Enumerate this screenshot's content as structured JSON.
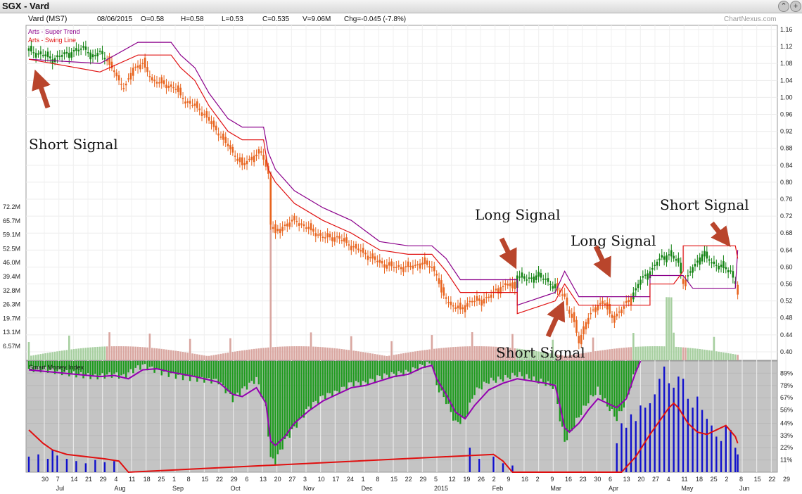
{
  "window": {
    "title": "SGX - Vard"
  },
  "info": {
    "symbol": "Vard (MS7)",
    "date": "08/06/2015",
    "open": "O=0.58",
    "high": "H=0.58",
    "low": "L=0.53",
    "close": "C=0.535",
    "volume": "V=9.06M",
    "change": "Chg=-0.045 (-7.8%)",
    "brand": "ChartNexus.com"
  },
  "legend": {
    "super_trend": "Arts - Super Trend",
    "swing_line": "Arts - Swing Line",
    "smi": "Smart Money Index"
  },
  "annotations": {
    "short1": "Short Signal",
    "long1": "Long Signal",
    "long2": "Long Signal",
    "short2": "Short Signal",
    "short3": "Short Signal"
  },
  "colors": {
    "down_candle": "#e8641e",
    "up_candle": "#128212",
    "super_trend": "#8b008b",
    "swing_line": "#e01010",
    "arrow": "#b9452c",
    "smi_bar": "#1c9a1c",
    "smi_bar_low": "#1111cc",
    "smi_line": "#9400b0",
    "smi_signal": "#e01010",
    "panel_bg": "#c4c4c4"
  },
  "chart_data": [
    {
      "type": "candlestick",
      "period": "Jul 2014 - Jun 2015",
      "price_axis": {
        "ticks": [
          "1.16",
          "1.12",
          "1.08",
          "1.04",
          "1.00",
          "0.96",
          "0.92",
          "0.88",
          "0.84",
          "0.80",
          "0.76",
          "0.72",
          "0.68",
          "0.64",
          "0.60",
          "0.56",
          "0.52",
          "0.48",
          "0.44",
          "0.40"
        ],
        "range": [
          0.38,
          1.17
        ]
      },
      "volume_axis": {
        "ticks": [
          "72.2M",
          "65.7M",
          "59.1M",
          "52.5M",
          "46.0M",
          "39.4M",
          "32.8M",
          "26.3M",
          "19.7M",
          "13.1M",
          "6.57M"
        ]
      },
      "x_ticks": [
        "30",
        "7",
        "14",
        "21",
        "29",
        "4",
        "11",
        "18",
        "25",
        "1",
        "8",
        "15",
        "22",
        "29",
        "6",
        "13",
        "20",
        "27",
        "3",
        "10",
        "17",
        "24",
        "1",
        "8",
        "15",
        "22",
        "29",
        "5",
        "12",
        "19",
        "26",
        "2",
        "9",
        "16",
        "2",
        "9",
        "16",
        "23",
        "30",
        "6",
        "13",
        "20",
        "27",
        "4",
        "11",
        "18",
        "25",
        "2",
        "8",
        "15",
        "22",
        "29"
      ],
      "x_months": [
        "Jul",
        "Aug",
        "Sep",
        "Oct",
        "Nov",
        "Dec",
        "2015",
        "Feb",
        "Mar",
        "Apr",
        "May",
        "Jun"
      ],
      "close_path": [
        [
          0,
          1.11
        ],
        [
          6,
          1.1
        ],
        [
          10,
          1.09
        ],
        [
          14,
          1.1
        ],
        [
          20,
          1.11
        ],
        [
          24,
          1.12
        ],
        [
          26,
          1.09
        ],
        [
          30,
          1.11
        ],
        [
          36,
          1.06
        ],
        [
          40,
          1.02
        ],
        [
          44,
          1.07
        ],
        [
          48,
          1.08
        ],
        [
          52,
          1.04
        ],
        [
          58,
          1.03
        ],
        [
          62,
          1.02
        ],
        [
          66,
          0.99
        ],
        [
          70,
          0.98
        ],
        [
          74,
          0.96
        ],
        [
          78,
          0.93
        ],
        [
          82,
          0.9
        ],
        [
          86,
          0.87
        ],
        [
          90,
          0.84
        ],
        [
          94,
          0.86
        ],
        [
          98,
          0.87
        ],
        [
          101,
          0.82
        ],
        [
          102,
          0.7
        ],
        [
          104,
          0.68
        ],
        [
          108,
          0.7
        ],
        [
          112,
          0.71
        ],
        [
          118,
          0.69
        ],
        [
          124,
          0.67
        ],
        [
          130,
          0.67
        ],
        [
          136,
          0.65
        ],
        [
          142,
          0.63
        ],
        [
          148,
          0.61
        ],
        [
          154,
          0.6
        ],
        [
          160,
          0.6
        ],
        [
          166,
          0.61
        ],
        [
          170,
          0.6
        ],
        [
          172,
          0.58
        ],
        [
          174,
          0.54
        ],
        [
          178,
          0.51
        ],
        [
          182,
          0.5
        ],
        [
          186,
          0.52
        ],
        [
          190,
          0.52
        ],
        [
          194,
          0.53
        ],
        [
          198,
          0.55
        ],
        [
          202,
          0.56
        ],
        [
          204,
          0.55
        ],
        [
          206,
          0.58
        ],
        [
          210,
          0.57
        ],
        [
          214,
          0.58
        ],
        [
          218,
          0.57
        ],
        [
          222,
          0.55
        ],
        [
          226,
          0.53
        ],
        [
          228,
          0.49
        ],
        [
          230,
          0.47
        ],
        [
          232,
          0.42
        ],
        [
          234,
          0.46
        ],
        [
          238,
          0.5
        ],
        [
          242,
          0.52
        ],
        [
          246,
          0.48
        ],
        [
          250,
          0.5
        ],
        [
          254,
          0.53
        ],
        [
          258,
          0.57
        ],
        [
          262,
          0.59
        ],
        [
          266,
          0.62
        ],
        [
          270,
          0.63
        ],
        [
          274,
          0.61
        ],
        [
          276,
          0.56
        ],
        [
          280,
          0.6
        ],
        [
          284,
          0.63
        ],
        [
          288,
          0.61
        ],
        [
          292,
          0.6
        ],
        [
          296,
          0.59
        ],
        [
          298,
          0.56
        ],
        [
          299,
          0.535
        ]
      ],
      "super_trend_path": [
        [
          0,
          1.09
        ],
        [
          30,
          1.08
        ],
        [
          46,
          1.13
        ],
        [
          60,
          1.13
        ],
        [
          64,
          1.1
        ],
        [
          70,
          1.07
        ],
        [
          76,
          1.01
        ],
        [
          84,
          0.95
        ],
        [
          90,
          0.93
        ],
        [
          99,
          0.93
        ],
        [
          101,
          0.87
        ],
        [
          104,
          0.83
        ],
        [
          112,
          0.78
        ],
        [
          124,
          0.74
        ],
        [
          136,
          0.71
        ],
        [
          148,
          0.66
        ],
        [
          160,
          0.65
        ],
        [
          170,
          0.65
        ],
        [
          176,
          0.62
        ],
        [
          182,
          0.57
        ],
        [
          206,
          0.57
        ],
        [
          206,
          0.51
        ],
        [
          222,
          0.54
        ],
        [
          226,
          0.59
        ],
        [
          232,
          0.53
        ],
        [
          262,
          0.53
        ],
        [
          262,
          0.58
        ],
        [
          276,
          0.58
        ],
        [
          280,
          0.55
        ],
        [
          298,
          0.55
        ],
        [
          299,
          0.64
        ]
      ],
      "swing_line_path": [
        [
          0,
          1.09
        ],
        [
          30,
          1.06
        ],
        [
          46,
          1.1
        ],
        [
          60,
          1.1
        ],
        [
          64,
          1.07
        ],
        [
          70,
          1.04
        ],
        [
          76,
          0.98
        ],
        [
          84,
          0.92
        ],
        [
          90,
          0.9
        ],
        [
          99,
          0.9
        ],
        [
          101,
          0.83
        ],
        [
          104,
          0.8
        ],
        [
          112,
          0.75
        ],
        [
          124,
          0.71
        ],
        [
          136,
          0.68
        ],
        [
          148,
          0.64
        ],
        [
          160,
          0.63
        ],
        [
          170,
          0.63
        ],
        [
          176,
          0.59
        ],
        [
          182,
          0.54
        ],
        [
          206,
          0.54
        ],
        [
          206,
          0.49
        ],
        [
          222,
          0.52
        ],
        [
          226,
          0.56
        ],
        [
          232,
          0.51
        ],
        [
          262,
          0.51
        ],
        [
          262,
          0.56
        ],
        [
          272,
          0.56
        ],
        [
          276,
          0.59
        ],
        [
          276,
          0.65
        ],
        [
          298,
          0.65
        ],
        [
          299,
          0.62
        ]
      ]
    },
    {
      "type": "bar",
      "title": "Smart Money Index",
      "axis": {
        "ticks": [
          "89%",
          "78%",
          "67%",
          "56%",
          "44%",
          "33%",
          "22%",
          "11%"
        ],
        "range": [
          0,
          100
        ]
      },
      "bar_path": [
        [
          0,
          93
        ],
        [
          8,
          92
        ],
        [
          14,
          90
        ],
        [
          20,
          88
        ],
        [
          28,
          86
        ],
        [
          36,
          88
        ],
        [
          40,
          86
        ],
        [
          44,
          92
        ],
        [
          48,
          96
        ],
        [
          56,
          90
        ],
        [
          64,
          86
        ],
        [
          72,
          84
        ],
        [
          80,
          82
        ],
        [
          86,
          66
        ],
        [
          90,
          74
        ],
        [
          96,
          84
        ],
        [
          100,
          58
        ],
        [
          102,
          12
        ],
        [
          104,
          10
        ],
        [
          108,
          28
        ],
        [
          112,
          40
        ],
        [
          118,
          58
        ],
        [
          124,
          68
        ],
        [
          130,
          72
        ],
        [
          136,
          80
        ],
        [
          142,
          80
        ],
        [
          148,
          86
        ],
        [
          154,
          88
        ],
        [
          160,
          90
        ],
        [
          166,
          96
        ],
        [
          170,
          98
        ],
        [
          172,
          78
        ],
        [
          176,
          64
        ],
        [
          180,
          44
        ],
        [
          184,
          48
        ],
        [
          188,
          72
        ],
        [
          194,
          82
        ],
        [
          200,
          84
        ],
        [
          206,
          88
        ],
        [
          212,
          84
        ],
        [
          218,
          80
        ],
        [
          222,
          76
        ],
        [
          224,
          48
        ],
        [
          226,
          28
        ],
        [
          228,
          34
        ],
        [
          232,
          50
        ],
        [
          236,
          64
        ],
        [
          240,
          74
        ],
        [
          244,
          60
        ],
        [
          248,
          48
        ],
        [
          252,
          64
        ],
        [
          256,
          92
        ],
        [
          258,
          100
        ]
      ],
      "blue_bars": [
        [
          0,
          14
        ],
        [
          4,
          16
        ],
        [
          8,
          12
        ],
        [
          10,
          20
        ],
        [
          12,
          15
        ],
        [
          16,
          12
        ],
        [
          20,
          10
        ],
        [
          24,
          8
        ],
        [
          28,
          11
        ],
        [
          32,
          9
        ],
        [
          36,
          10
        ],
        [
          186,
          22
        ],
        [
          190,
          12
        ],
        [
          196,
          14
        ],
        [
          200,
          8
        ],
        [
          204,
          6
        ],
        [
          248,
          26
        ],
        [
          250,
          44
        ],
        [
          252,
          40
        ],
        [
          254,
          52
        ],
        [
          256,
          46
        ],
        [
          258,
          60
        ],
        [
          260,
          58
        ],
        [
          262,
          62
        ],
        [
          264,
          70
        ],
        [
          266,
          84
        ],
        [
          268,
          95
        ],
        [
          270,
          80
        ],
        [
          272,
          76
        ],
        [
          274,
          86
        ],
        [
          276,
          84
        ],
        [
          278,
          66
        ],
        [
          280,
          58
        ],
        [
          282,
          68
        ],
        [
          284,
          56
        ],
        [
          286,
          48
        ],
        [
          288,
          42
        ],
        [
          290,
          32
        ],
        [
          292,
          28
        ],
        [
          294,
          42
        ],
        [
          296,
          38
        ],
        [
          298,
          22
        ],
        [
          299,
          16
        ]
      ],
      "smi_line_path": [
        [
          0,
          92
        ],
        [
          10,
          90
        ],
        [
          20,
          88
        ],
        [
          30,
          86
        ],
        [
          36,
          87
        ],
        [
          42,
          84
        ],
        [
          48,
          92
        ],
        [
          54,
          93
        ],
        [
          60,
          90
        ],
        [
          70,
          86
        ],
        [
          80,
          81
        ],
        [
          86,
          70
        ],
        [
          90,
          68
        ],
        [
          96,
          76
        ],
        [
          100,
          62
        ],
        [
          102,
          28
        ],
        [
          104,
          24
        ],
        [
          108,
          32
        ],
        [
          112,
          44
        ],
        [
          118,
          55
        ],
        [
          124,
          64
        ],
        [
          130,
          70
        ],
        [
          136,
          76
        ],
        [
          142,
          78
        ],
        [
          148,
          82
        ],
        [
          154,
          86
        ],
        [
          160,
          88
        ],
        [
          166,
          94
        ],
        [
          170,
          96
        ],
        [
          172,
          84
        ],
        [
          176,
          70
        ],
        [
          180,
          54
        ],
        [
          184,
          48
        ],
        [
          188,
          60
        ],
        [
          194,
          74
        ],
        [
          200,
          80
        ],
        [
          206,
          84
        ],
        [
          212,
          82
        ],
        [
          218,
          80
        ],
        [
          222,
          78
        ],
        [
          224,
          60
        ],
        [
          226,
          40
        ],
        [
          228,
          36
        ],
        [
          232,
          44
        ],
        [
          236,
          56
        ],
        [
          240,
          66
        ],
        [
          244,
          62
        ],
        [
          248,
          58
        ],
        [
          252,
          66
        ],
        [
          256,
          90
        ],
        [
          258,
          100
        ]
      ],
      "smi_signal_path": [
        [
          0,
          38
        ],
        [
          6,
          26
        ],
        [
          10,
          20
        ],
        [
          16,
          16
        ],
        [
          24,
          14
        ],
        [
          32,
          12
        ],
        [
          38,
          10
        ],
        [
          42,
          0
        ],
        [
          196,
          16
        ],
        [
          200,
          10
        ],
        [
          204,
          0
        ],
        [
          250,
          0
        ],
        [
          256,
          14
        ],
        [
          262,
          34
        ],
        [
          266,
          46
        ],
        [
          270,
          58
        ],
        [
          272,
          62
        ],
        [
          274,
          58
        ],
        [
          278,
          44
        ],
        [
          282,
          36
        ],
        [
          286,
          34
        ],
        [
          290,
          38
        ],
        [
          294,
          42
        ],
        [
          298,
          32
        ],
        [
          299,
          26
        ]
      ]
    }
  ]
}
